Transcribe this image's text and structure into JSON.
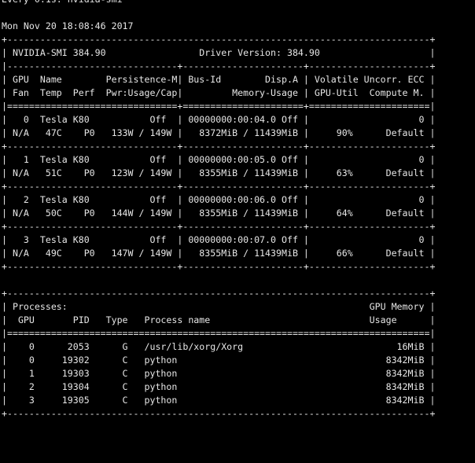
{
  "terminal": {
    "lines": [
      "Every 0.1s: nvidia-smi",
      "",
      "Mon Nov 20 18:08:46 2017",
      "+-----------------------------------------------------------------------------+",
      "| NVIDIA-SMI 384.90                 Driver Version: 384.90                    |",
      "|-------------------------------+----------------------+----------------------+",
      "| GPU  Name        Persistence-M| Bus-Id        Disp.A | Volatile Uncorr. ECC |",
      "| Fan  Temp  Perf  Pwr:Usage/Cap|         Memory-Usage | GPU-Util  Compute M. |",
      "|===============================+======================+======================|",
      "|   0  Tesla K80           Off  | 00000000:00:04.0 Off |                    0 |",
      "| N/A   47C    P0   133W / 149W |   8372MiB / 11439MiB |     90%      Default |",
      "+-------------------------------+----------------------+----------------------+",
      "|   1  Tesla K80           Off  | 00000000:00:05.0 Off |                    0 |",
      "| N/A   51C    P0   123W / 149W |   8355MiB / 11439MiB |     63%      Default |",
      "+-------------------------------+----------------------+----------------------+",
      "|   2  Tesla K80           Off  | 00000000:00:06.0 Off |                    0 |",
      "| N/A   50C    P0   144W / 149W |   8355MiB / 11439MiB |     64%      Default |",
      "+-------------------------------+----------------------+----------------------+",
      "|   3  Tesla K80           Off  | 00000000:00:07.0 Off |                    0 |",
      "| N/A   49C    P0   147W / 149W |   8355MiB / 11439MiB |     66%      Default |",
      "+-------------------------------+----------------------+----------------------+",
      "",
      "+-----------------------------------------------------------------------------+",
      "| Processes:                                                       GPU Memory |",
      "|  GPU       PID   Type   Process name                             Usage      |",
      "|=============================================================================|",
      "|    0      2053      G   /usr/lib/xorg/Xorg                            16MiB |",
      "|    0     19302      C   python                                      8342MiB |",
      "|    1     19303      C   python                                      8342MiB |",
      "|    2     19304      C   python                                      8342MiB |",
      "|    3     19305      C   python                                      8342MiB |",
      "+-----------------------------------------------------------------------------+"
    ]
  },
  "colors": {
    "background": "#000000",
    "text": "#e6e6e6"
  }
}
